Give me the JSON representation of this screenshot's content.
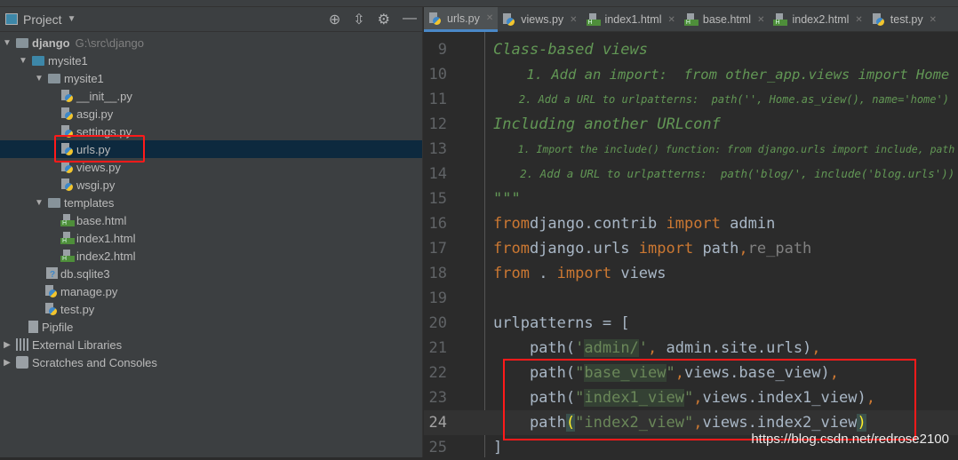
{
  "project_panel": {
    "title": "Project",
    "header_icons": [
      "locate-icon",
      "collapse-icon",
      "gear-icon",
      "minimize-icon"
    ]
  },
  "tree": [
    {
      "label": "django",
      "path": "G:\\src\\django",
      "type": "folder",
      "depth": 0,
      "open": true,
      "bold": true
    },
    {
      "label": "mysite1",
      "type": "folder-blue",
      "depth": 1,
      "open": true
    },
    {
      "label": "mysite1",
      "type": "folder",
      "depth": 2,
      "open": true
    },
    {
      "label": "__init__.py",
      "type": "py",
      "depth": 3
    },
    {
      "label": "asgi.py",
      "type": "py",
      "depth": 3
    },
    {
      "label": "settings.py",
      "type": "py",
      "depth": 3
    },
    {
      "label": "urls.py",
      "type": "py",
      "depth": 3,
      "selected": true
    },
    {
      "label": "views.py",
      "type": "py",
      "depth": 3
    },
    {
      "label": "wsgi.py",
      "type": "py",
      "depth": 3
    },
    {
      "label": "templates",
      "type": "folder",
      "depth": 2,
      "open": true
    },
    {
      "label": "base.html",
      "type": "html",
      "depth": 3
    },
    {
      "label": "index1.html",
      "type": "html",
      "depth": 3
    },
    {
      "label": "index2.html",
      "type": "html",
      "depth": 3
    },
    {
      "label": "db.sqlite3",
      "type": "db",
      "depth": 2
    },
    {
      "label": "manage.py",
      "type": "py",
      "depth": 2
    },
    {
      "label": "test.py",
      "type": "py",
      "depth": 2
    },
    {
      "label": "Pipfile",
      "type": "txt",
      "depth": 1
    },
    {
      "label": "External Libraries",
      "type": "lib",
      "depth": 0,
      "open": false
    },
    {
      "label": "Scratches and Consoles",
      "type": "scr",
      "depth": 0,
      "open": false
    }
  ],
  "tabs": [
    {
      "label": "urls.py",
      "type": "py",
      "active": true
    },
    {
      "label": "views.py",
      "type": "py"
    },
    {
      "label": "index1.html",
      "type": "html"
    },
    {
      "label": "base.html",
      "type": "html"
    },
    {
      "label": "index2.html",
      "type": "html"
    },
    {
      "label": "test.py",
      "type": "py"
    }
  ],
  "editor": {
    "current_line": 24,
    "lines": [
      {
        "n": "9",
        "parts": [
          [
            "cm",
            "Class-based views"
          ]
        ]
      },
      {
        "n": "10",
        "parts": [
          [
            "cm",
            "    1. Add an import:  from other_app.views import Home"
          ]
        ]
      },
      {
        "n": "11",
        "parts": [
          [
            "cm",
            "    2. Add a URL to urlpatterns:  path('', Home.as_view(), name='home')"
          ]
        ]
      },
      {
        "n": "12",
        "parts": [
          [
            "cm",
            "Including another URLconf"
          ]
        ]
      },
      {
        "n": "13",
        "parts": [
          [
            "cm",
            "    1. Import the include() function: from django.urls import include, path"
          ]
        ]
      },
      {
        "n": "14",
        "parts": [
          [
            "cm",
            "    2. Add a URL to urlpatterns:  path('blog/', include('blog.urls'))"
          ]
        ]
      },
      {
        "n": "15",
        "parts": [
          [
            "cm",
            "\"\"\""
          ]
        ]
      },
      {
        "n": "16",
        "parts": [
          [
            "kw",
            "from"
          ],
          [
            "",
            "django.contrib "
          ],
          [
            "kw",
            "import"
          ],
          [
            "",
            " admin"
          ]
        ]
      },
      {
        "n": "17",
        "parts": [
          [
            "kw",
            "from"
          ],
          [
            "",
            "django.urls "
          ],
          [
            "kw",
            "import"
          ],
          [
            "",
            " path"
          ],
          [
            "kw",
            ","
          ],
          [
            "dim",
            "re_path"
          ]
        ]
      },
      {
        "n": "18",
        "parts": [
          [
            "kw",
            "from"
          ],
          [
            "",
            " . "
          ],
          [
            "kw",
            "import"
          ],
          [
            "",
            " views"
          ]
        ]
      },
      {
        "n": "19",
        "parts": []
      },
      {
        "n": "20",
        "parts": [
          [
            "",
            "urlpatterns = ["
          ]
        ]
      },
      {
        "n": "21",
        "parts": [
          [
            "",
            "    path("
          ],
          [
            "str",
            "'"
          ],
          [
            "str strbg",
            "admin/"
          ],
          [
            "str",
            "'"
          ],
          [
            "kw",
            ", "
          ],
          [
            "",
            "admin.site.urls)"
          ],
          [
            "kw",
            ","
          ]
        ]
      },
      {
        "n": "22",
        "parts": [
          [
            "",
            "    path("
          ],
          [
            "str",
            "\""
          ],
          [
            "str strbg",
            "base_view"
          ],
          [
            "str",
            "\""
          ],
          [
            "kw",
            ","
          ],
          [
            "",
            "views.base_view)"
          ],
          [
            "kw",
            ","
          ]
        ]
      },
      {
        "n": "23",
        "parts": [
          [
            "",
            "    path("
          ],
          [
            "str",
            "\""
          ],
          [
            "str strbg",
            "index1_view"
          ],
          [
            "str",
            "\""
          ],
          [
            "kw",
            ","
          ],
          [
            "",
            "views.index1_view)"
          ],
          [
            "kw",
            ","
          ]
        ]
      },
      {
        "n": "24",
        "parts": [
          [
            "",
            "    path"
          ],
          [
            "brk",
            "("
          ],
          [
            "str",
            "\"index2_view\""
          ],
          [
            "kw",
            ","
          ],
          [
            "",
            "views.index2_view"
          ],
          [
            "brk",
            ")"
          ]
        ]
      },
      {
        "n": "25",
        "parts": [
          [
            "",
            "]"
          ]
        ]
      }
    ]
  },
  "watermark": "https://blog.csdn.net/redrose2100"
}
